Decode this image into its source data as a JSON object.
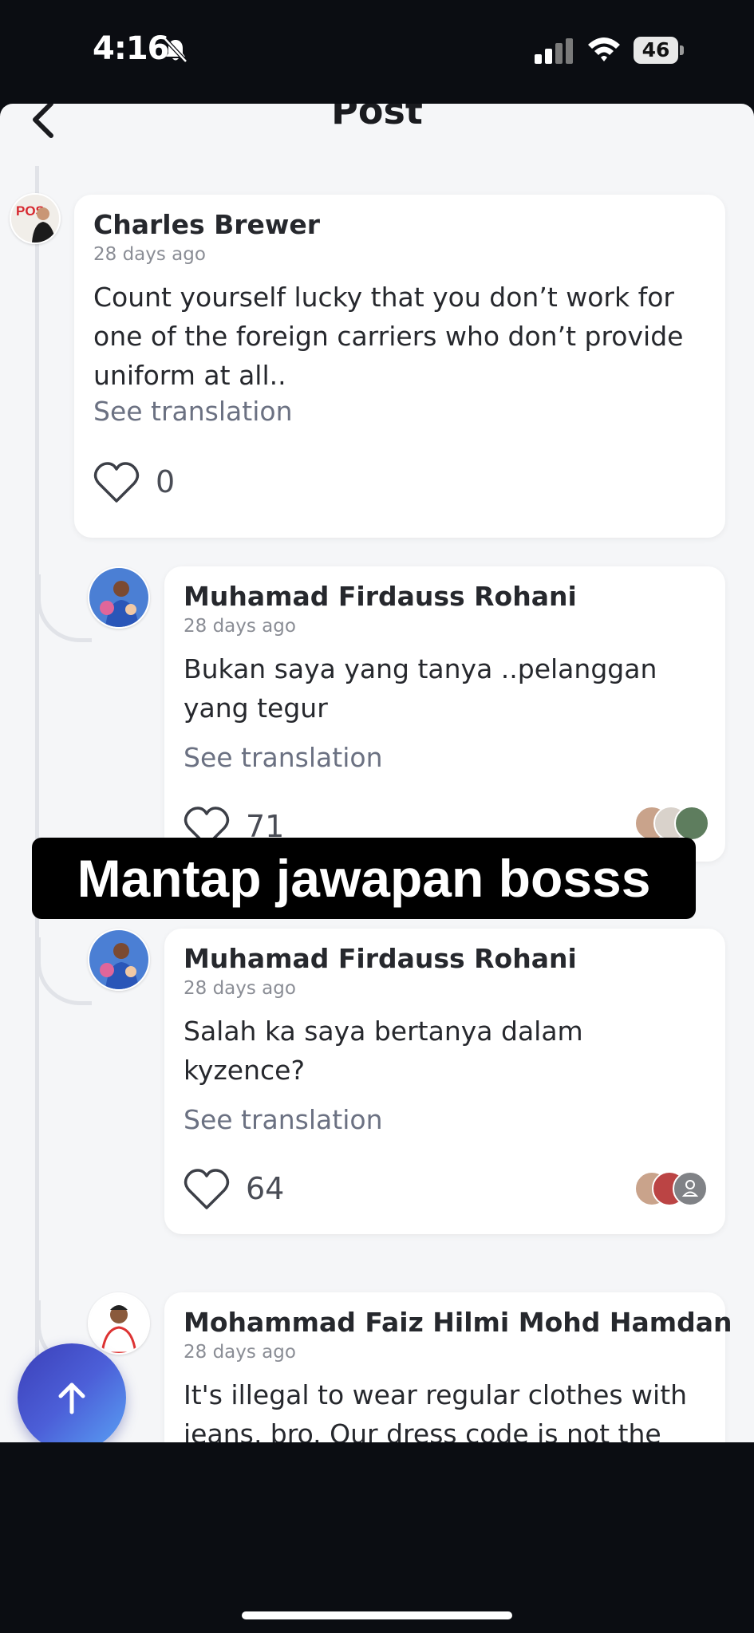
{
  "status_bar": {
    "time": "4:16",
    "battery": "46"
  },
  "header": {
    "title": "Post",
    "back_icon": "chevron-left-icon"
  },
  "comments": [
    {
      "author": "Charles Brewer",
      "time_ago": "28 days ago",
      "text": "Count yourself lucky that you don’t work for one of the foreign carriers who don’t provide uniform at all..",
      "see_translation": "See translation",
      "likes": "0"
    },
    {
      "author": "Muhamad Firdauss Rohani",
      "time_ago": "28 days ago",
      "text": "Bukan saya yang tanya ..pelanggan yang tegur",
      "see_translation": "See translation",
      "likes": "71"
    },
    {
      "author": "Muhamad Firdauss Rohani",
      "time_ago": "28 days ago",
      "text": "Salah ka saya bertanya dalam kyzence?",
      "see_translation": "See translation",
      "likes": "64"
    },
    {
      "author": "Mohammad Faiz Hilmi Mohd Hamdan",
      "time_ago": "28 days ago",
      "text": "It's illegal to wear regular clothes with jeans, bro. Our dress code is not the"
    }
  ],
  "caption": "Mantap jawapan bosss",
  "fab": {
    "icon": "arrow-up-icon"
  },
  "colors": {
    "accent": "#4a5bd6",
    "background": "#f5f6f8",
    "card": "#ffffff"
  }
}
